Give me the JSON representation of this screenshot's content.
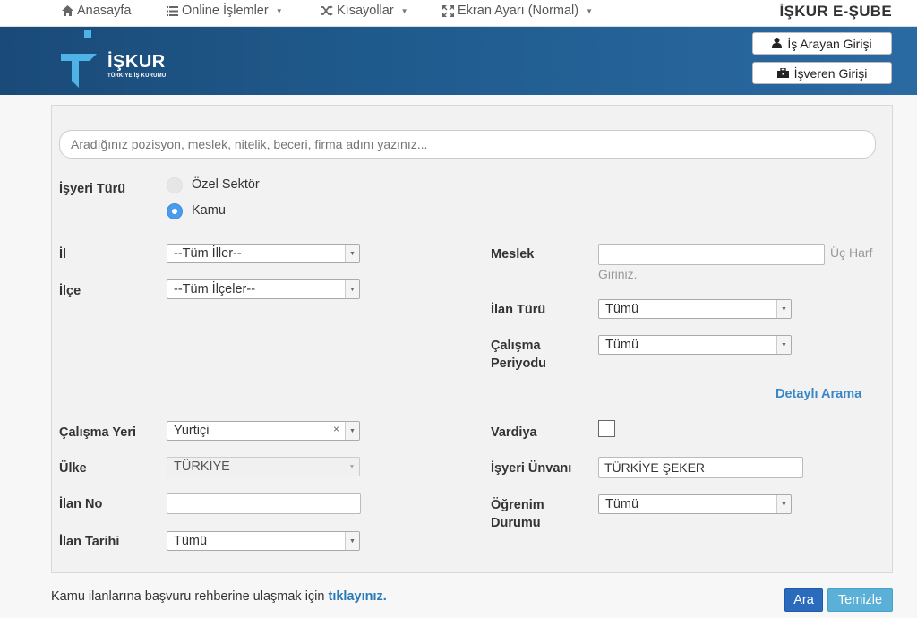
{
  "nav": {
    "items": [
      {
        "label": "Anasayfa",
        "icon": "home-icon",
        "dropdown": false
      },
      {
        "label": "Online İşlemler",
        "icon": "list-icon",
        "dropdown": true
      },
      {
        "label": "Kısayollar",
        "icon": "shuffle-icon",
        "dropdown": true
      },
      {
        "label": "Ekran Ayarı (Normal)",
        "icon": "expand-icon",
        "dropdown": true
      }
    ],
    "brand": "İŞKUR E-ŞUBE"
  },
  "header": {
    "logo_name": "İŞKUR",
    "logo_sub": "TÜRKİYE İŞ KURUMU",
    "job_seeker_login": "İş Arayan Girişi",
    "employer_login": "İşveren Girişi"
  },
  "search": {
    "placeholder": "Aradığınız pozisyon, meslek, nitelik, beceri, firma adını yazınız..."
  },
  "form": {
    "workplace_type_label": "İşyeri Türü",
    "workplace_type_options": [
      {
        "label": "Özel Sektör",
        "selected": false
      },
      {
        "label": "Kamu",
        "selected": true
      }
    ],
    "province_label": "İl",
    "province_value": "--Tüm İller--",
    "district_label": "İlçe",
    "district_value": "--Tüm İlçeler--",
    "occupation_label": "Meslek",
    "occupation_value": "",
    "occupation_hint": "Üç Harf Giriniz.",
    "ad_type_label": "İlan Türü",
    "ad_type_value": "Tümü",
    "work_period_label_1": "Çalışma",
    "work_period_label_2": "Periyodu",
    "work_period_value": "Tümü",
    "detailed_search": "Detaylı Arama",
    "work_location_label": "Çalışma Yeri",
    "work_location_value": "Yurtiçi",
    "country_label": "Ülke",
    "country_value": "TÜRKİYE",
    "ad_no_label": "İlan No",
    "ad_no_value": "",
    "ad_date_label": "İlan Tarihi",
    "ad_date_value": "Tümü",
    "shift_label": "Vardiya",
    "shift_checked": false,
    "employer_title_label": "İşyeri Ünvanı",
    "employer_title_value": "TÜRKİYE ŞEKER",
    "education_label_1": "Öğrenim",
    "education_label_2": "Durumu",
    "education_value": "Tümü"
  },
  "footer": {
    "text": "Kamu ilanlarına başvuru rehberine ulaşmak için",
    "link": "tıklayınız.",
    "search_button": "Ara",
    "clear_button": "Temizle"
  },
  "colors": {
    "header_blue": "#1f5a8c",
    "link_blue": "#3a87c8",
    "radio_checked": "#4a9bec",
    "primary_button": "#2a6bbd",
    "secondary_button": "#5bb0d8"
  }
}
